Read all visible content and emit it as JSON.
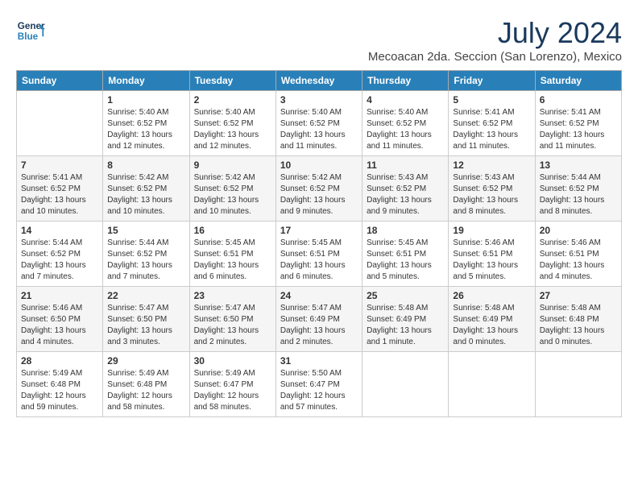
{
  "logo": {
    "line1": "General",
    "line2": "Blue"
  },
  "title": "July 2024",
  "location": "Mecoacan 2da. Seccion (San Lorenzo), Mexico",
  "headers": [
    "Sunday",
    "Monday",
    "Tuesday",
    "Wednesday",
    "Thursday",
    "Friday",
    "Saturday"
  ],
  "weeks": [
    [
      {
        "day": "",
        "info": ""
      },
      {
        "day": "1",
        "info": "Sunrise: 5:40 AM\nSunset: 6:52 PM\nDaylight: 13 hours\nand 12 minutes."
      },
      {
        "day": "2",
        "info": "Sunrise: 5:40 AM\nSunset: 6:52 PM\nDaylight: 13 hours\nand 12 minutes."
      },
      {
        "day": "3",
        "info": "Sunrise: 5:40 AM\nSunset: 6:52 PM\nDaylight: 13 hours\nand 11 minutes."
      },
      {
        "day": "4",
        "info": "Sunrise: 5:40 AM\nSunset: 6:52 PM\nDaylight: 13 hours\nand 11 minutes."
      },
      {
        "day": "5",
        "info": "Sunrise: 5:41 AM\nSunset: 6:52 PM\nDaylight: 13 hours\nand 11 minutes."
      },
      {
        "day": "6",
        "info": "Sunrise: 5:41 AM\nSunset: 6:52 PM\nDaylight: 13 hours\nand 11 minutes."
      }
    ],
    [
      {
        "day": "7",
        "info": "Sunrise: 5:41 AM\nSunset: 6:52 PM\nDaylight: 13 hours\nand 10 minutes."
      },
      {
        "day": "8",
        "info": "Sunrise: 5:42 AM\nSunset: 6:52 PM\nDaylight: 13 hours\nand 10 minutes."
      },
      {
        "day": "9",
        "info": "Sunrise: 5:42 AM\nSunset: 6:52 PM\nDaylight: 13 hours\nand 10 minutes."
      },
      {
        "day": "10",
        "info": "Sunrise: 5:42 AM\nSunset: 6:52 PM\nDaylight: 13 hours\nand 9 minutes."
      },
      {
        "day": "11",
        "info": "Sunrise: 5:43 AM\nSunset: 6:52 PM\nDaylight: 13 hours\nand 9 minutes."
      },
      {
        "day": "12",
        "info": "Sunrise: 5:43 AM\nSunset: 6:52 PM\nDaylight: 13 hours\nand 8 minutes."
      },
      {
        "day": "13",
        "info": "Sunrise: 5:44 AM\nSunset: 6:52 PM\nDaylight: 13 hours\nand 8 minutes."
      }
    ],
    [
      {
        "day": "14",
        "info": "Sunrise: 5:44 AM\nSunset: 6:52 PM\nDaylight: 13 hours\nand 7 minutes."
      },
      {
        "day": "15",
        "info": "Sunrise: 5:44 AM\nSunset: 6:52 PM\nDaylight: 13 hours\nand 7 minutes."
      },
      {
        "day": "16",
        "info": "Sunrise: 5:45 AM\nSunset: 6:51 PM\nDaylight: 13 hours\nand 6 minutes."
      },
      {
        "day": "17",
        "info": "Sunrise: 5:45 AM\nSunset: 6:51 PM\nDaylight: 13 hours\nand 6 minutes."
      },
      {
        "day": "18",
        "info": "Sunrise: 5:45 AM\nSunset: 6:51 PM\nDaylight: 13 hours\nand 5 minutes."
      },
      {
        "day": "19",
        "info": "Sunrise: 5:46 AM\nSunset: 6:51 PM\nDaylight: 13 hours\nand 5 minutes."
      },
      {
        "day": "20",
        "info": "Sunrise: 5:46 AM\nSunset: 6:51 PM\nDaylight: 13 hours\nand 4 minutes."
      }
    ],
    [
      {
        "day": "21",
        "info": "Sunrise: 5:46 AM\nSunset: 6:50 PM\nDaylight: 13 hours\nand 4 minutes."
      },
      {
        "day": "22",
        "info": "Sunrise: 5:47 AM\nSunset: 6:50 PM\nDaylight: 13 hours\nand 3 minutes."
      },
      {
        "day": "23",
        "info": "Sunrise: 5:47 AM\nSunset: 6:50 PM\nDaylight: 13 hours\nand 2 minutes."
      },
      {
        "day": "24",
        "info": "Sunrise: 5:47 AM\nSunset: 6:49 PM\nDaylight: 13 hours\nand 2 minutes."
      },
      {
        "day": "25",
        "info": "Sunrise: 5:48 AM\nSunset: 6:49 PM\nDaylight: 13 hours\nand 1 minute."
      },
      {
        "day": "26",
        "info": "Sunrise: 5:48 AM\nSunset: 6:49 PM\nDaylight: 13 hours\nand 0 minutes."
      },
      {
        "day": "27",
        "info": "Sunrise: 5:48 AM\nSunset: 6:48 PM\nDaylight: 13 hours\nand 0 minutes."
      }
    ],
    [
      {
        "day": "28",
        "info": "Sunrise: 5:49 AM\nSunset: 6:48 PM\nDaylight: 12 hours\nand 59 minutes."
      },
      {
        "day": "29",
        "info": "Sunrise: 5:49 AM\nSunset: 6:48 PM\nDaylight: 12 hours\nand 58 minutes."
      },
      {
        "day": "30",
        "info": "Sunrise: 5:49 AM\nSunset: 6:47 PM\nDaylight: 12 hours\nand 58 minutes."
      },
      {
        "day": "31",
        "info": "Sunrise: 5:50 AM\nSunset: 6:47 PM\nDaylight: 12 hours\nand 57 minutes."
      },
      {
        "day": "",
        "info": ""
      },
      {
        "day": "",
        "info": ""
      },
      {
        "day": "",
        "info": ""
      }
    ]
  ]
}
